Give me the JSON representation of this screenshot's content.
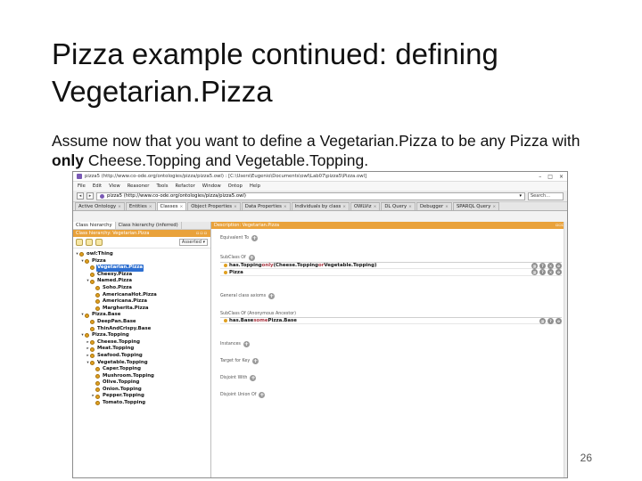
{
  "slide": {
    "title": "Pizza example continued: defining Vegetarian.Pizza",
    "body_part1": "Assume now that you want to define a Vegetarian.Pizza to be any Pizza with ",
    "body_bold": "only",
    "body_part2": " Cheese.Topping and Vegetable.Topping.",
    "page_number": "26"
  },
  "app": {
    "window_title": "pizza5 (http://www.co-ode.org/ontologies/pizza/pizza5.owl) : [C:\\Users\\Eugenio\\Documents\\owl\\Lab07\\pizza5\\Pizza.owl]",
    "window_controls": [
      "–",
      "□",
      "×"
    ],
    "menu": [
      "File",
      "Edit",
      "View",
      "Reasoner",
      "Tools",
      "Refactor",
      "Window",
      "Ontop",
      "Help"
    ],
    "address": "pizza5 (http://www.co-ode.org/ontologies/pizza/pizza5.owl)",
    "search_placeholder": "Search...",
    "tabs": [
      {
        "label": "Active Ontology",
        "active": false
      },
      {
        "label": "Entities",
        "active": false
      },
      {
        "label": "Classes",
        "active": true
      },
      {
        "label": "Object Properties",
        "active": false
      },
      {
        "label": "Data Properties",
        "active": false
      },
      {
        "label": "Individuals by class",
        "active": false
      },
      {
        "label": "OWLViz",
        "active": false
      },
      {
        "label": "DL Query",
        "active": false
      },
      {
        "label": "Debugger",
        "active": false
      },
      {
        "label": "SPARQL Query",
        "active": false
      }
    ],
    "left": {
      "subtabs": [
        "Class hierarchy",
        "Class hierarchy (inferred)"
      ],
      "header": "Class hierarchy: Vegetarian.Pizza",
      "asserted": "Asserted ▾",
      "tree": [
        {
          "label": "owl:Thing",
          "depth": 0,
          "toggle": "▾",
          "selected": false
        },
        {
          "label": "Pizza",
          "depth": 1,
          "toggle": "▾",
          "selected": false
        },
        {
          "label": "Vegetarian.Pizza",
          "depth": 2,
          "toggle": "",
          "selected": true
        },
        {
          "label": "Cheesy.Pizza",
          "depth": 2,
          "toggle": "",
          "selected": false
        },
        {
          "label": "Named.Pizza",
          "depth": 2,
          "toggle": "▾",
          "selected": false
        },
        {
          "label": "Soho.Pizza",
          "depth": 3,
          "toggle": "",
          "selected": false
        },
        {
          "label": "AmericanaHot.Pizza",
          "depth": 3,
          "toggle": "",
          "selected": false
        },
        {
          "label": "Americana.Pizza",
          "depth": 3,
          "toggle": "",
          "selected": false
        },
        {
          "label": "Margherita.Pizza",
          "depth": 3,
          "toggle": "",
          "selected": false
        },
        {
          "label": "Pizza.Base",
          "depth": 1,
          "toggle": "▾",
          "selected": false
        },
        {
          "label": "DeepPan.Base",
          "depth": 2,
          "toggle": "",
          "selected": false
        },
        {
          "label": "ThinAndCrispy.Base",
          "depth": 2,
          "toggle": "",
          "selected": false
        },
        {
          "label": "Pizza.Topping",
          "depth": 1,
          "toggle": "▾",
          "selected": false
        },
        {
          "label": "Cheese.Topping",
          "depth": 2,
          "toggle": "▸",
          "selected": false
        },
        {
          "label": "Meat.Topping",
          "depth": 2,
          "toggle": "▸",
          "selected": false
        },
        {
          "label": "Seafood.Topping",
          "depth": 2,
          "toggle": "▸",
          "selected": false
        },
        {
          "label": "Vegetable.Topping",
          "depth": 2,
          "toggle": "▾",
          "selected": false
        },
        {
          "label": "Caper.Topping",
          "depth": 3,
          "toggle": "",
          "selected": false
        },
        {
          "label": "Mushroom.Topping",
          "depth": 3,
          "toggle": "",
          "selected": false
        },
        {
          "label": "Olive.Topping",
          "depth": 3,
          "toggle": "",
          "selected": false
        },
        {
          "label": "Onion.Topping",
          "depth": 3,
          "toggle": "",
          "selected": false
        },
        {
          "label": "Pepper.Topping",
          "depth": 3,
          "toggle": "▸",
          "selected": false
        },
        {
          "label": "Tomato.Topping",
          "depth": 3,
          "toggle": "",
          "selected": false
        }
      ]
    },
    "right": {
      "header": "Description: Vegetarian.Pizza",
      "equivalent_to": "Equivalent To",
      "subclass_of": "SubClass Of",
      "subclass_entries": [
        {
          "prefix": "has.Topping ",
          "kw1": "only",
          "mid": " (Cheese.Topping ",
          "kw2": "or",
          "suffix": " Vegetable.Topping)"
        },
        {
          "prefix": "Pizza",
          "kw1": "",
          "mid": "",
          "kw2": "",
          "suffix": ""
        }
      ],
      "general_axioms": "General class axioms",
      "inherited": "SubClass Of (Anonymous Ancestor)",
      "inherited_entry": {
        "prefix": "has.Base ",
        "kw1": "some",
        "suffix": " Pizza.Base"
      },
      "instances": "Instances",
      "target_for_key": "Target for Key",
      "disjoint_with": "Disjoint With",
      "disjoint_union": "Disjoint Union Of"
    }
  }
}
